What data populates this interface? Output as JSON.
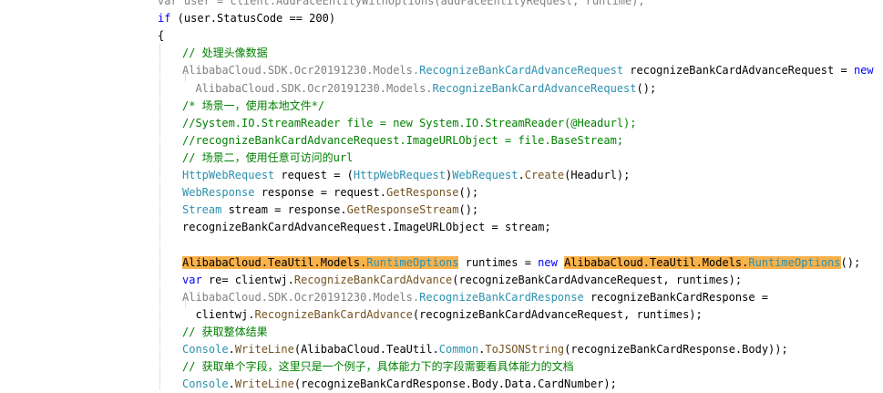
{
  "editor": {
    "colors": {
      "keyword": "#0000ff",
      "type": "#2b91af",
      "comment": "#008000",
      "text": "#000000",
      "dimmed": "#808080",
      "method": "#74531f",
      "highlight": "#f9b14a"
    },
    "lines": [
      {
        "id": "line-0",
        "tokens": [
          {
            "t": "var user = client.AddFaceEntityWithOptions(addFaceEntityRequest, runtime);",
            "c": "dimmed"
          }
        ]
      },
      {
        "id": "line-1",
        "tokens": [
          {
            "t": "if",
            "c": "keyword"
          },
          {
            "t": " (user.StatusCode == 200)",
            "c": "text"
          }
        ]
      },
      {
        "id": "line-2",
        "tokens": [
          {
            "t": "{",
            "c": "text"
          }
        ]
      },
      {
        "id": "line-3",
        "tokens": [
          {
            "t": "// 处理头像数据",
            "c": "comment"
          }
        ]
      },
      {
        "id": "line-4",
        "tokens": [
          {
            "t": "AlibabaCloud.SDK.Ocr20191230.Models.",
            "c": "dimmed"
          },
          {
            "t": "RecognizeBankCardAdvanceRequest",
            "c": "type"
          },
          {
            "t": " recognizeBankCardAdvanceRequest = ",
            "c": "text"
          },
          {
            "t": "new",
            "c": "keyword"
          }
        ]
      },
      {
        "id": "line-5",
        "tokens": [
          {
            "t": "  AlibabaCloud.SDK.Ocr20191230.Models.",
            "c": "dimmed"
          },
          {
            "t": "RecognizeBankCardAdvanceRequest",
            "c": "type"
          },
          {
            "t": "();",
            "c": "text"
          }
        ]
      },
      {
        "id": "line-6",
        "tokens": [
          {
            "t": "/* 场景一，使用本地文件*/",
            "c": "comment"
          }
        ]
      },
      {
        "id": "line-7",
        "tokens": [
          {
            "t": "//System.IO.StreamReader file = new System.IO.StreamReader(@Headurl);",
            "c": "comment"
          }
        ]
      },
      {
        "id": "line-8",
        "tokens": [
          {
            "t": "//recognizeBankCardAdvanceRequest.ImageURLObject = file.BaseStream;",
            "c": "comment"
          }
        ]
      },
      {
        "id": "line-9",
        "tokens": [
          {
            "t": "// 场景二，使用任意可访问的url",
            "c": "comment"
          }
        ]
      },
      {
        "id": "line-10",
        "tokens": [
          {
            "t": "HttpWebRequest",
            "c": "type"
          },
          {
            "t": " request = (",
            "c": "text"
          },
          {
            "t": "HttpWebRequest",
            "c": "type"
          },
          {
            "t": ")",
            "c": "text"
          },
          {
            "t": "WebRequest",
            "c": "type"
          },
          {
            "t": ".",
            "c": "text"
          },
          {
            "t": "Create",
            "c": "method"
          },
          {
            "t": "(Headurl);",
            "c": "text"
          }
        ]
      },
      {
        "id": "line-11",
        "tokens": [
          {
            "t": "WebResponse",
            "c": "type"
          },
          {
            "t": " response = request.",
            "c": "text"
          },
          {
            "t": "GetResponse",
            "c": "method"
          },
          {
            "t": "();",
            "c": "text"
          }
        ]
      },
      {
        "id": "line-12",
        "tokens": [
          {
            "t": "Stream",
            "c": "type"
          },
          {
            "t": " stream = response.",
            "c": "text"
          },
          {
            "t": "GetResponseStream",
            "c": "method"
          },
          {
            "t": "();",
            "c": "text"
          }
        ]
      },
      {
        "id": "line-13",
        "tokens": [
          {
            "t": "recognizeBankCardAdvanceRequest.ImageURLObject = stream;",
            "c": "text"
          }
        ]
      },
      {
        "id": "line-14",
        "tokens": []
      },
      {
        "id": "line-15",
        "tokens": [
          {
            "t": "AlibabaCloud.TeaUtil.Models.",
            "c": "text",
            "hl": true
          },
          {
            "t": "RuntimeOptions",
            "c": "type",
            "hl": true
          },
          {
            "t": " runtimes = ",
            "c": "text"
          },
          {
            "t": "new",
            "c": "keyword"
          },
          {
            "t": " ",
            "c": "text"
          },
          {
            "t": "AlibabaCloud.TeaUtil.Models.",
            "c": "text",
            "hl": true
          },
          {
            "t": "RuntimeOptions",
            "c": "type",
            "hl": true
          },
          {
            "t": "();",
            "c": "text"
          }
        ]
      },
      {
        "id": "line-16",
        "tokens": [
          {
            "t": "var",
            "c": "keyword"
          },
          {
            "t": " re= clientwj.",
            "c": "text"
          },
          {
            "t": "RecognizeBankCardAdvance",
            "c": "method"
          },
          {
            "t": "(recognizeBankCardAdvanceRequest, runtimes);",
            "c": "text"
          }
        ]
      },
      {
        "id": "line-17",
        "tokens": [
          {
            "t": "AlibabaCloud.SDK.Ocr20191230.Models.",
            "c": "dimmed"
          },
          {
            "t": "RecognizeBankCardResponse",
            "c": "type"
          },
          {
            "t": " recognizeBankCardResponse =",
            "c": "text"
          }
        ]
      },
      {
        "id": "line-18",
        "tokens": [
          {
            "t": "  clientwj.",
            "c": "text"
          },
          {
            "t": "RecognizeBankCardAdvance",
            "c": "method"
          },
          {
            "t": "(recognizeBankCardAdvanceRequest, runtimes);",
            "c": "text"
          }
        ]
      },
      {
        "id": "line-19",
        "tokens": [
          {
            "t": "// 获取整体结果",
            "c": "comment"
          }
        ]
      },
      {
        "id": "line-20",
        "tokens": [
          {
            "t": "Console",
            "c": "type"
          },
          {
            "t": ".",
            "c": "text"
          },
          {
            "t": "WriteLine",
            "c": "method"
          },
          {
            "t": "(AlibabaCloud.TeaUtil.",
            "c": "text"
          },
          {
            "t": "Common",
            "c": "type"
          },
          {
            "t": ".",
            "c": "text"
          },
          {
            "t": "ToJSONString",
            "c": "method"
          },
          {
            "t": "(recognizeBankCardResponse.Body));",
            "c": "text"
          }
        ]
      },
      {
        "id": "line-21",
        "tokens": [
          {
            "t": "// 获取单个字段，这里只是一个例子，具体能力下的字段需要看具体能力的文档",
            "c": "comment"
          }
        ]
      },
      {
        "id": "line-22",
        "tokens": [
          {
            "t": "Console",
            "c": "type"
          },
          {
            "t": ".",
            "c": "text"
          },
          {
            "t": "WriteLine",
            "c": "method"
          },
          {
            "t": "(recognizeBankCardResponse.Body.Data.CardNumber);",
            "c": "text"
          }
        ]
      }
    ]
  }
}
